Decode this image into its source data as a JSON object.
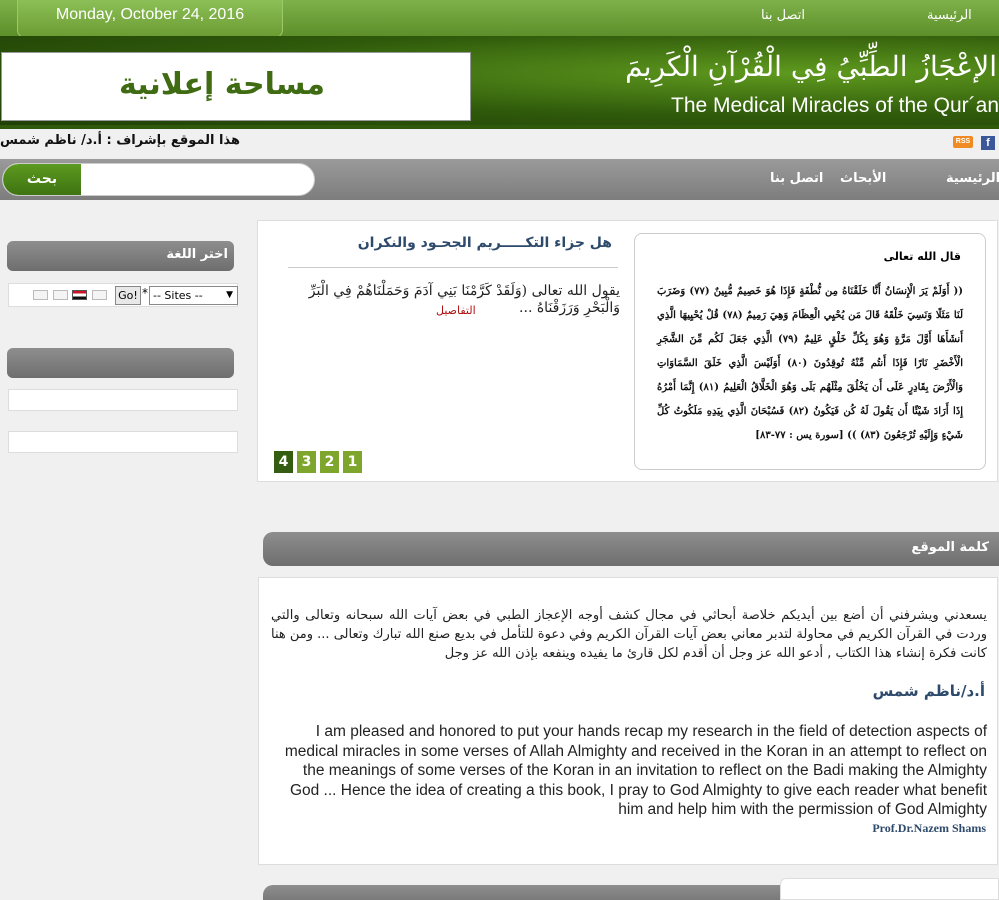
{
  "topbar": {
    "date": "Monday, October 24, 2016",
    "links": {
      "home": "الرئيسية",
      "contact": "اتصل بنا"
    }
  },
  "header": {
    "ad_text": "مساحة إعلانية",
    "logo_ar": "الإعْجَازُ الطِّبِّيُ فِي الْقُرْآنِ الْكَرِيمَ",
    "logo_en": "The Medical Miracles of the Qur´an"
  },
  "supervisor": "هذا الموقع بإشراف : أ.د/ ناظم شمس",
  "icons": {
    "facebook": "facebook-icon",
    "rss": "rss-icon",
    "rss_label": "RSS",
    "fb_label": "f"
  },
  "nav": {
    "search_button": "بحث",
    "search_placeholder": "",
    "items": {
      "home": "الرئيسية",
      "research": "الأبحاث",
      "contact": "اتصل بنا"
    }
  },
  "sidebar": {
    "language_title": "اختر اللغة",
    "go_label": "Go!",
    "star": "*",
    "sites_option": "-- Sites --",
    "second_title": ""
  },
  "slider": {
    "title": "هل جزاء التكـــــريم الجحـود والنكران",
    "text": "يقول الله تعالى (وَلَقَدْ كَرَّمْنَا بَنِي آدَمَ وَحَمَلْنَاهُمْ فِي الْبَرِّ وَالْبَحْرِ وَرَزَقْنَاهُ ...",
    "details": "التفاصيل",
    "pages": [
      "4",
      "3",
      "2",
      "1"
    ],
    "active_page": "4",
    "verse_heading": "قال الله تعالى",
    "verse_text": "(( أَوَلَمْ يَرَ الْإِنسَانُ أَنَّا خَلَقْنَاهُ مِن نُّطْفَةٍ فَإِذَا هُوَ خَصِيمٌ مُّبِينٌ (٧٧) وَضَرَبَ لَنَا مَثَلًا وَنَسِيَ خَلْقَهُ قَالَ مَن يُحْيِي الْعِظَامَ وَهِيَ رَمِيمٌ (٧٨) قُلْ يُحْيِيهَا الَّذِي أَنشَأَهَا أَوَّلَ مَرَّةٍ وَهُوَ بِكُلِّ خَلْقٍ عَلِيمٌ (٧٩) الَّذِي جَعَلَ لَكُم مِّنَ الشَّجَرِ الْأَخْضَرِ نَارًا فَإِذَا أَنتُم مِّنْهُ تُوقِدُونَ (٨٠) أَوَلَيْسَ الَّذِي خَلَقَ السَّمَاوَاتِ وَالْأَرْضَ بِقَادِرٍ عَلَى أَن يَخْلُقَ مِثْلَهُم بَلَى وَهُوَ الْخَلَّاقُ الْعَلِيمُ (٨١) إِنَّمَا أَمْرُهُ إِذَا أَرَادَ شَيْئًا أَن يَقُولَ لَهُ كُن فَيَكُونُ (٨٢) فَسُبْحَانَ الَّذِي بِيَدِهِ مَلَكُوتُ كُلِّ شَيْءٍ وَإِلَيْهِ تُرْجَعُونَ (٨٣) )) [سورة يس : ٧٧-٨٣]"
  },
  "site_word": {
    "title": "كلمة الموقع",
    "arabic": "يسعدني ويشرفني أن أضع بين أيديكم خلاصة أبحاثي في مجال كشف أوجه الإعجاز الطبي في بعض آيات الله سبحانه وتعالى والتي وردت في القرآن الكريم في محاولة لتدبر معاني بعض آيات القرآن الكريم وفي دعوة للتأمل في بديع صنع الله تبارك وتعالى ... ومن هنا كانت فكرة إنشاء هذا الكتاب , أدعو الله عز وجل أن أقدم لكل قارئ ما يفيده وينفعه بإذن الله عز وجل",
    "signature_ar": "أ.د/ناظم شمس",
    "english": "I am pleased and honored to put your hands recap my research in the field of detection aspects of medical miracles in some verses of Allah Almighty and received in the Koran in an attempt to reflect on the meanings of some verses of the Koran in an invitation to reflect on the Badi making the Almighty God ... Hence the idea of creating a this book, I pray to God Almighty to give each reader what benefit him and help him with the permission of God Almighty",
    "signature_en": "Prof.Dr.Nazem Shams"
  }
}
